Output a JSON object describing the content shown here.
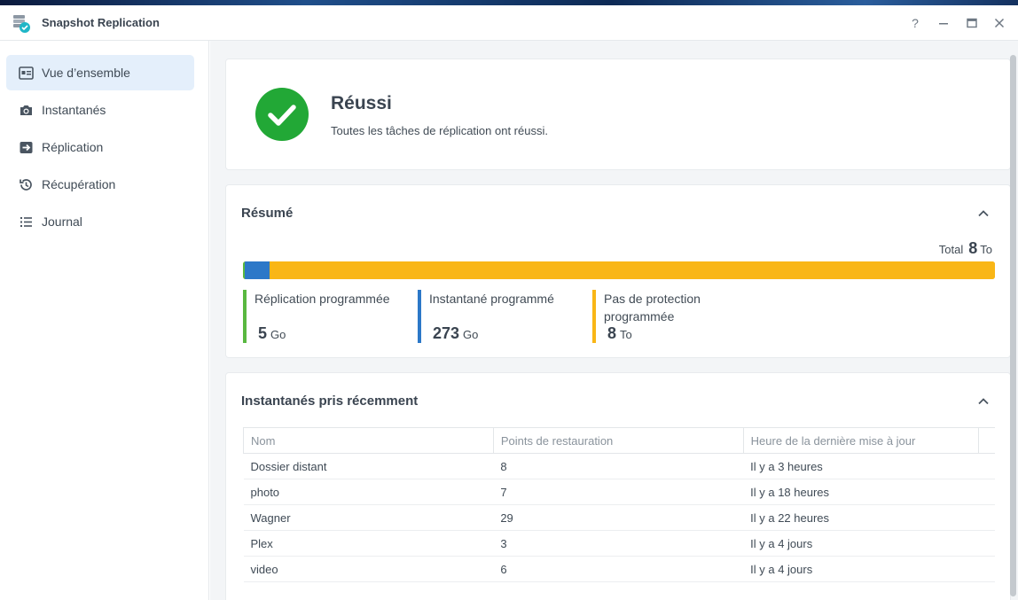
{
  "window": {
    "title": "Snapshot Replication",
    "controls": {
      "help": "?",
      "minimize": "—",
      "maximize": "☐",
      "close": "✕"
    }
  },
  "sidebar": {
    "items": [
      {
        "label": "Vue d’ensemble",
        "icon": "overview-icon",
        "active": true
      },
      {
        "label": "Instantanés",
        "icon": "camera-icon",
        "active": false
      },
      {
        "label": "Réplication",
        "icon": "replication-icon",
        "active": false
      },
      {
        "label": "Récupération",
        "icon": "history-icon",
        "active": false
      },
      {
        "label": "Journal",
        "icon": "list-icon",
        "active": false
      }
    ]
  },
  "status": {
    "title": "Réussi",
    "message": "Toutes les tâches de réplication ont réussi.",
    "icon": "success-check-icon",
    "color": "#22a836"
  },
  "summary": {
    "title": "Résumé",
    "total_label": "Total",
    "total_value": "8",
    "total_unit": "To",
    "segments": [
      {
        "label": "Réplication programmée",
        "value": "5",
        "unit": "Go",
        "color": "#59b840",
        "fraction": 0.0006
      },
      {
        "label": "Instantané programmé",
        "value": "273",
        "unit": "Go",
        "color": "#2c78c8",
        "fraction": 0.033
      },
      {
        "label": "Pas de protection programmée",
        "value": "8",
        "unit": "To",
        "color": "#f9b616",
        "fraction": 0.966
      }
    ]
  },
  "recent": {
    "title": "Instantanés pris récemment",
    "columns": [
      "Nom",
      "Points de restauration",
      "Heure de la dernière mise à jour"
    ],
    "rows": [
      [
        "Dossier distant",
        "8",
        "Il y a 3 heures"
      ],
      [
        "photo",
        "7",
        "Il y a 18 heures"
      ],
      [
        "Wagner",
        "29",
        "Il y a 22 heures"
      ],
      [
        "Plex",
        "3",
        "Il y a 4 jours"
      ],
      [
        "video",
        "6",
        "Il y a 4 jours"
      ]
    ]
  }
}
